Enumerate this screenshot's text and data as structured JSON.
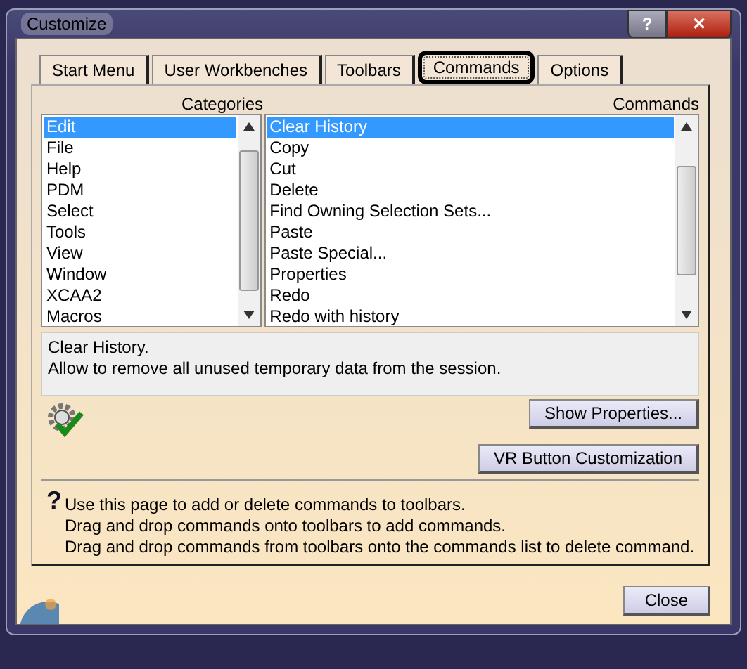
{
  "window": {
    "title": "Customize",
    "help_button": "?",
    "close_button": "✕"
  },
  "tabs": [
    {
      "label": "Start Menu",
      "selected": false
    },
    {
      "label": "User Workbenches",
      "selected": false
    },
    {
      "label": "Toolbars",
      "selected": false
    },
    {
      "label": "Commands",
      "selected": true
    },
    {
      "label": "Options",
      "selected": false
    }
  ],
  "categories": {
    "header": "Categories",
    "items": [
      {
        "label": "Edit",
        "selected": true
      },
      {
        "label": "File",
        "selected": false
      },
      {
        "label": "Help",
        "selected": false
      },
      {
        "label": "PDM",
        "selected": false
      },
      {
        "label": "Select",
        "selected": false
      },
      {
        "label": "Tools",
        "selected": false
      },
      {
        "label": "View",
        "selected": false
      },
      {
        "label": "Window",
        "selected": false
      },
      {
        "label": "XCAA2",
        "selected": false
      },
      {
        "label": "Macros",
        "selected": false
      }
    ]
  },
  "commands": {
    "header": "Commands",
    "items": [
      {
        "label": "Clear History",
        "selected": true
      },
      {
        "label": "Copy",
        "selected": false
      },
      {
        "label": "Cut",
        "selected": false
      },
      {
        "label": "Delete",
        "selected": false
      },
      {
        "label": "Find Owning Selection Sets...",
        "selected": false
      },
      {
        "label": "Paste",
        "selected": false
      },
      {
        "label": "Paste Special...",
        "selected": false
      },
      {
        "label": "Properties",
        "selected": false
      },
      {
        "label": "Redo",
        "selected": false
      },
      {
        "label": "Redo with history",
        "selected": false
      }
    ]
  },
  "description": [
    "Clear History.",
    "Allow to remove all unused temporary data from the session."
  ],
  "buttons": [
    "Show Properties...",
    "VR Button Customization"
  ],
  "help": {
    "icon": "?",
    "lines": [
      "Use this page to add or delete commands to toolbars.",
      "Drag and drop commands onto toolbars to add commands.",
      "Drag and drop commands from toolbars onto the commands list to delete command."
    ]
  },
  "footer_button": "Close"
}
